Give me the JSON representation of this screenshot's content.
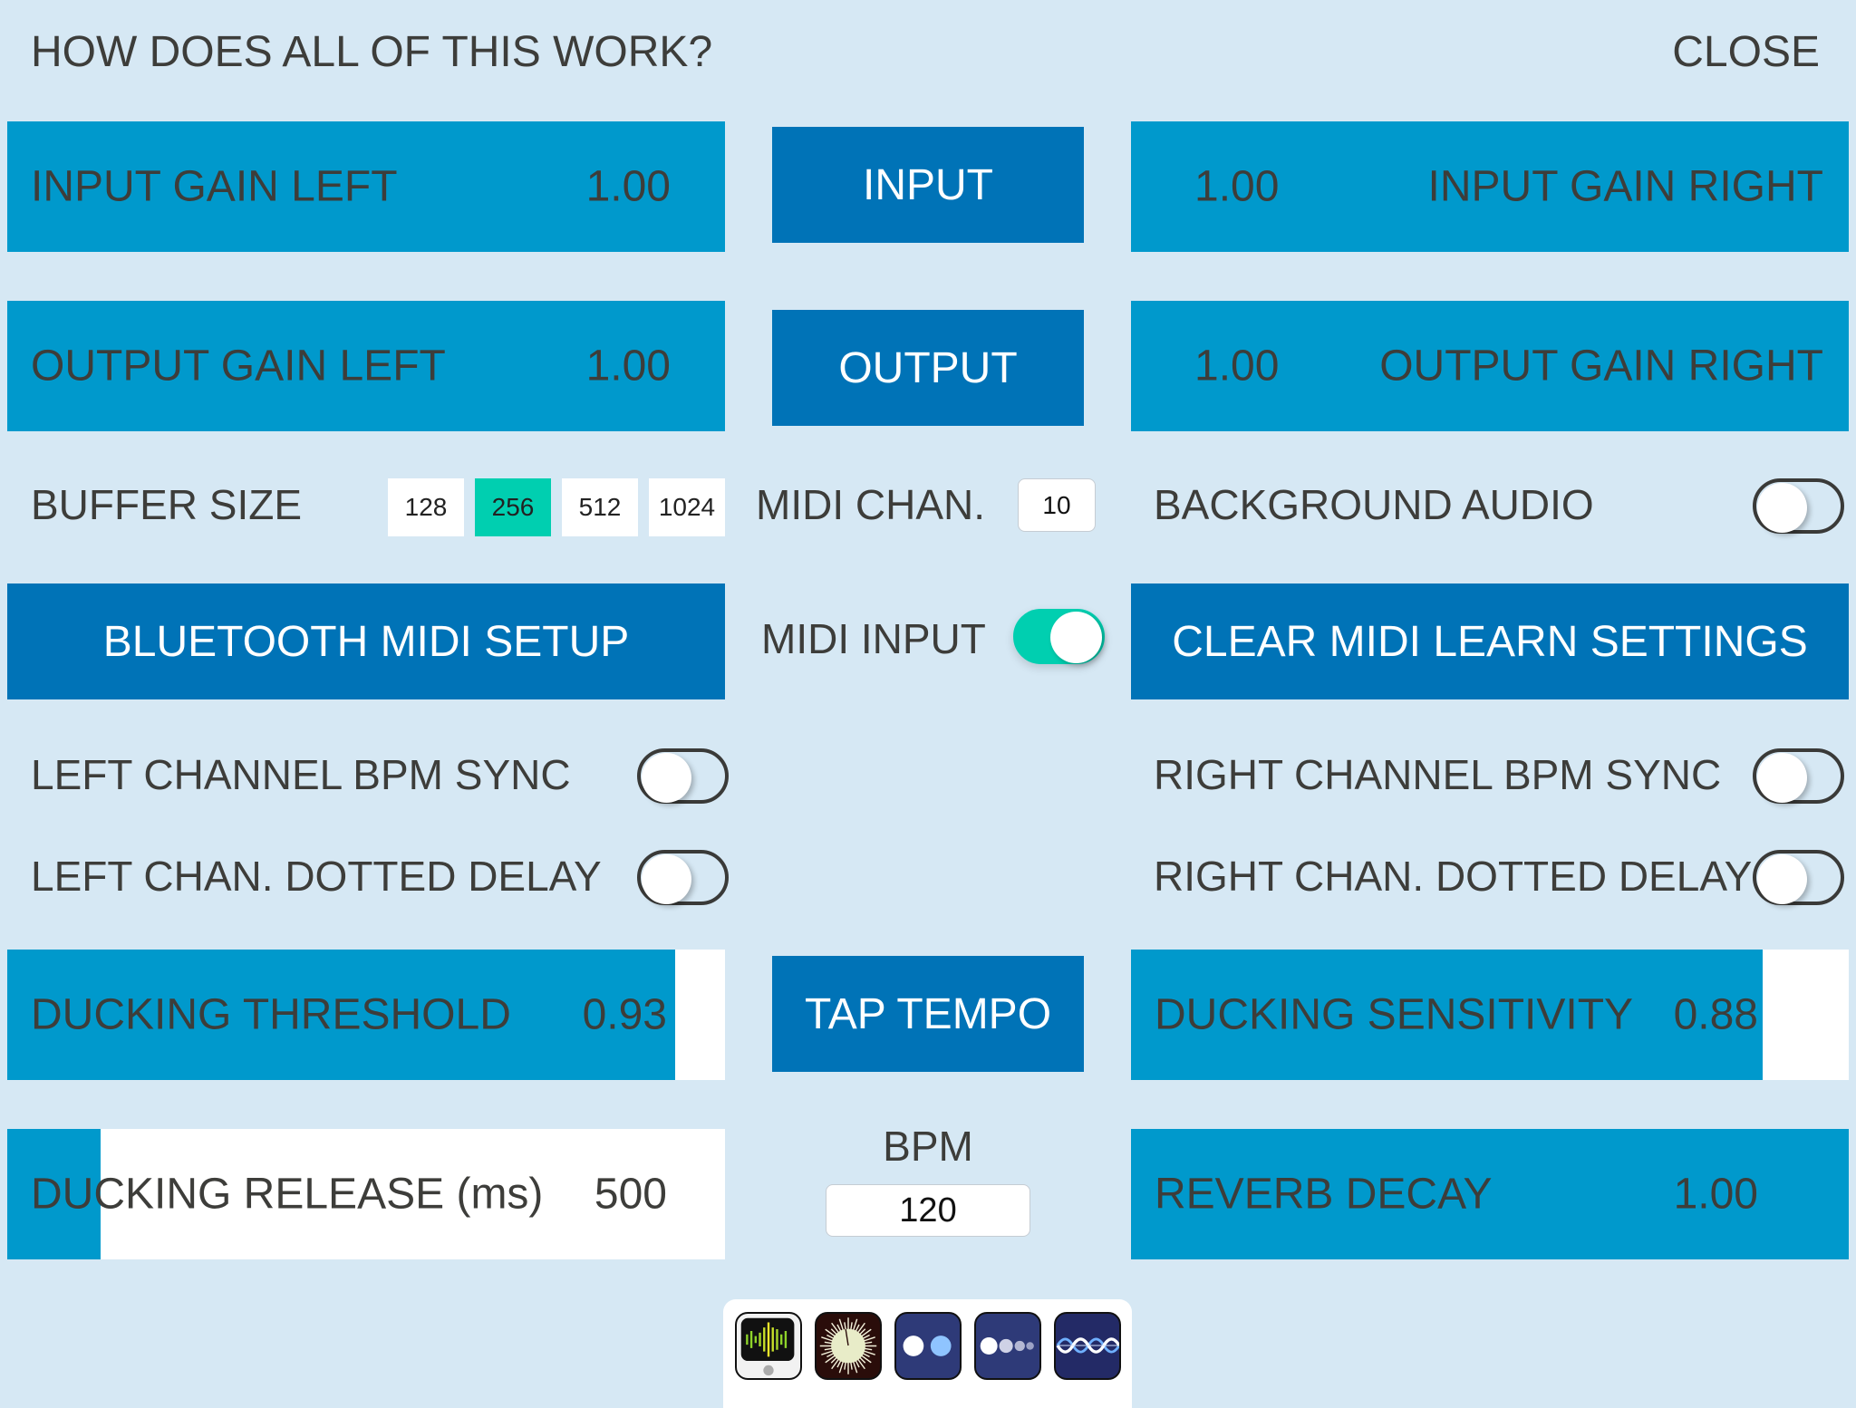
{
  "header": {
    "help_link": "HOW DOES ALL OF THIS WORK?",
    "close_label": "CLOSE"
  },
  "input_row": {
    "left": {
      "label": "INPUT GAIN LEFT",
      "value": "1.00"
    },
    "center_button": "INPUT",
    "right": {
      "label": "INPUT GAIN RIGHT",
      "value": "1.00"
    }
  },
  "output_row": {
    "left": {
      "label": "OUTPUT GAIN LEFT",
      "value": "1.00"
    },
    "center_button": "OUTPUT",
    "right": {
      "label": "OUTPUT GAIN RIGHT",
      "value": "1.00"
    }
  },
  "buffer": {
    "label": "BUFFER SIZE",
    "options": [
      "128",
      "256",
      "512",
      "1024"
    ],
    "selected": "256"
  },
  "midi_channel": {
    "label": "MIDI CHAN.",
    "value": "10"
  },
  "background_audio": {
    "label": "BACKGROUND AUDIO",
    "on": false
  },
  "bluetooth_button": "BLUETOOTH MIDI SETUP",
  "midi_input": {
    "label": "MIDI INPUT",
    "on": true
  },
  "clear_midi_button": "CLEAR MIDI LEARN SETTINGS",
  "left_bpm_sync": {
    "label": "LEFT CHANNEL BPM SYNC",
    "on": false
  },
  "right_bpm_sync": {
    "label": "RIGHT CHANNEL BPM SYNC",
    "on": false
  },
  "left_dotted_delay": {
    "label": "LEFT CHAN. DOTTED DELAY",
    "on": false
  },
  "right_dotted_delay": {
    "label": "RIGHT CHAN. DOTTED DELAY",
    "on": false
  },
  "ducking_threshold": {
    "label": "DUCKING THRESHOLD",
    "value": "0.93",
    "fill": 0.93
  },
  "tap_tempo_button": "TAP TEMPO",
  "ducking_sensitivity": {
    "label": "DUCKING SENSITIVITY",
    "value": "0.88",
    "fill": 0.88
  },
  "ducking_release": {
    "label": "DUCKING RELEASE (ms)",
    "value": "500",
    "fill": 0.13
  },
  "bpm": {
    "label": "BPM",
    "value": "120"
  },
  "reverb_decay": {
    "label": "REVERB DECAY",
    "value": "1.00"
  },
  "dock": {
    "apps": [
      {
        "name": "audio-meter-app-icon"
      },
      {
        "name": "starburst-app-icon"
      },
      {
        "name": "two-dots-app-icon"
      },
      {
        "name": "four-dots-app-icon"
      },
      {
        "name": "waveform-app-icon"
      }
    ]
  },
  "colors": {
    "background": "#d6e8f4",
    "panel": "#0099cc",
    "button": "#0073b7",
    "accent": "#00cfb0",
    "text": "#3d3d3a"
  }
}
